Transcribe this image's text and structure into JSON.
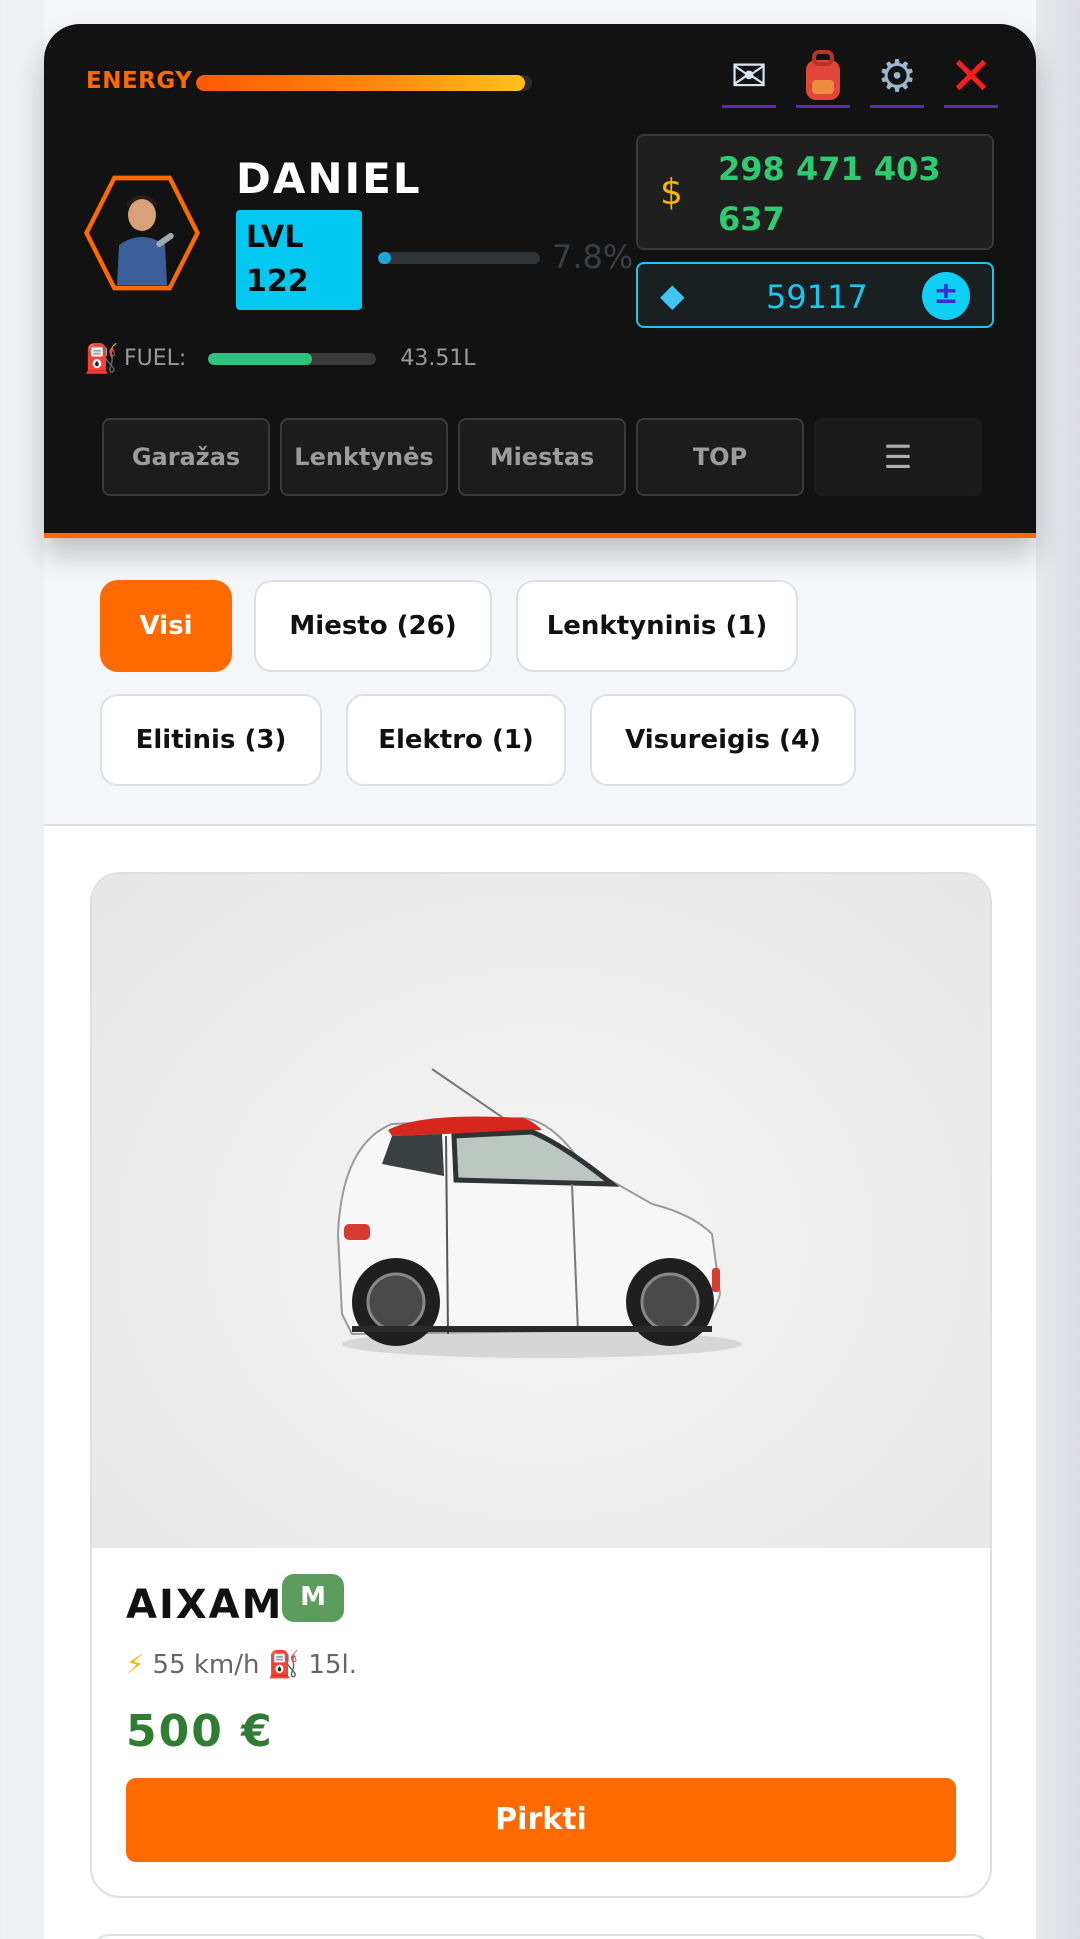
{
  "header": {
    "energy_label": "ENERGY",
    "energy_level": 0.98,
    "icons": [
      "envelope-icon",
      "backpack-icon",
      "gear-icon",
      "close-icon"
    ],
    "player": {
      "name": "DANIEL",
      "lvl_label": "LVL",
      "lvl_value": "122",
      "xp_percent_text": "7.8%",
      "xp_fraction": 0.078
    },
    "fuel": {
      "label": "FUEL:",
      "value": "43.51L",
      "fraction": 0.62
    },
    "money": "298 471 403 637",
    "gems": "59117",
    "gem_plus": "±",
    "nav": [
      "Garažas",
      "Lenktynės",
      "Miestas",
      "TOP",
      "☰"
    ]
  },
  "filters": [
    "Visi",
    "Miesto (26)",
    "Lenktyninis (1)",
    "Elitinis (3)",
    "Elektro (1)",
    "Visureigis (4)"
  ],
  "car": {
    "name": "AIXAM",
    "class": "M",
    "speed": "55 km/h",
    "fuel": "15l.",
    "price": "500 €",
    "buy_label": "Pirkti"
  },
  "colors": {
    "accent": "#ff6a00",
    "money": "#2ecc71",
    "gem": "#18c8f0",
    "class_badge": "#5c9d5e",
    "price": "#2e7d32"
  }
}
